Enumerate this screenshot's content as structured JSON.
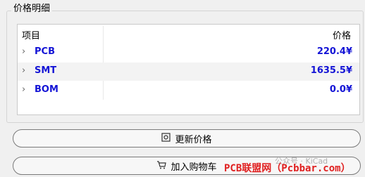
{
  "group": {
    "title": "价格明细"
  },
  "tree": {
    "columns": {
      "item": "项目",
      "price": "价格"
    },
    "rows": [
      {
        "name": "PCB",
        "price": "220.4¥"
      },
      {
        "name": "SMT",
        "price": "1635.5¥"
      },
      {
        "name": "BOM",
        "price": "0.0¥"
      }
    ]
  },
  "buttons": {
    "refresh_label": "更新价格",
    "cart_label": "加入购物车"
  },
  "watermark": {
    "main": "PCB联盟网（Pcbbar.com）",
    "faint": "公众号 · KiCad"
  },
  "icons": {
    "expander": "chevron-right-icon",
    "refresh": "refresh-price-icon",
    "cart": "shopping-cart-icon"
  },
  "colors": {
    "link": "#1414d6",
    "watermark": "#e02020"
  }
}
